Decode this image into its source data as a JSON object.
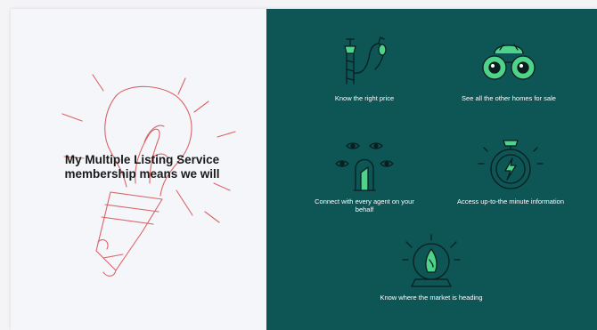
{
  "colors": {
    "panel_bg": "#0e5556",
    "left_bg": "#f5f6fa",
    "line_art": "#d96468",
    "icon_line": "#0a1f1f",
    "icon_accent": "#4fd38a",
    "label_text": "#ffffff",
    "headline_text": "#1a1a1a"
  },
  "headline": {
    "line1": "My Multiple Listing Service",
    "line2": "membership means we will"
  },
  "benefits": [
    {
      "label": "Know the right price",
      "icon": "hand-with-weights-icon"
    },
    {
      "label": "See all the other homes for sale",
      "icon": "binoculars-icon"
    },
    {
      "label": "Connect with every agent on your behalf",
      "icon": "agent-with-eyes-icon"
    },
    {
      "label": "Access up-to-the minute information",
      "icon": "stopwatch-icon"
    },
    {
      "label": "Know where the market is heading",
      "icon": "crystal-ball-icon"
    }
  ]
}
